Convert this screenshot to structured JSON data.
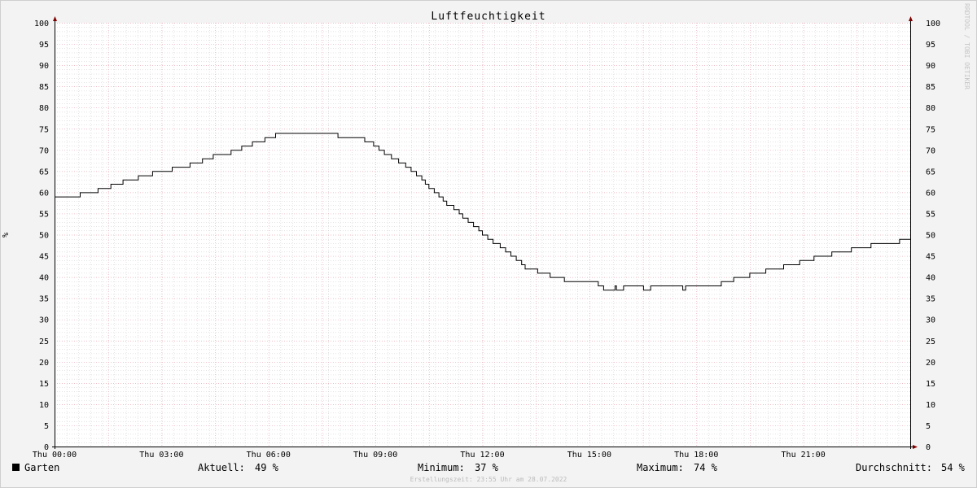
{
  "chart_data": {
    "type": "line",
    "title": "Luftfeuchtigkeit",
    "ylabel": "%",
    "ylim": [
      0,
      100
    ],
    "yticks": [
      0,
      5,
      10,
      15,
      20,
      25,
      30,
      35,
      40,
      45,
      50,
      55,
      60,
      65,
      70,
      75,
      80,
      85,
      90,
      95,
      100
    ],
    "xlim": [
      0,
      24
    ],
    "xticks": [
      {
        "value": 0,
        "label": "Thu 00:00"
      },
      {
        "value": 3,
        "label": "Thu 03:00"
      },
      {
        "value": 6,
        "label": "Thu 06:00"
      },
      {
        "value": 9,
        "label": "Thu 09:00"
      },
      {
        "value": 12,
        "label": "Thu 12:00"
      },
      {
        "value": 15,
        "label": "Thu 15:00"
      },
      {
        "value": 18,
        "label": "Thu 18:00"
      },
      {
        "value": 21,
        "label": "Thu 21:00"
      }
    ],
    "grid": true,
    "line_color": "#000000",
    "grid_minor_color": "#c8c8c8",
    "grid_major_color": "#e6a8b4",
    "arrow_color": "#800000",
    "series": [
      {
        "name": "Garten",
        "points": [
          [
            0.0,
            59
          ],
          [
            0.72,
            60
          ],
          [
            1.22,
            61
          ],
          [
            1.58,
            62
          ],
          [
            1.92,
            63
          ],
          [
            2.35,
            64
          ],
          [
            2.75,
            65
          ],
          [
            3.3,
            66
          ],
          [
            3.8,
            67
          ],
          [
            4.15,
            68
          ],
          [
            4.45,
            69
          ],
          [
            4.95,
            70
          ],
          [
            5.25,
            71
          ],
          [
            5.55,
            72
          ],
          [
            5.9,
            73
          ],
          [
            6.2,
            74
          ],
          [
            7.95,
            73
          ],
          [
            8.7,
            72
          ],
          [
            8.95,
            71
          ],
          [
            9.1,
            70
          ],
          [
            9.25,
            69
          ],
          [
            9.45,
            68
          ],
          [
            9.65,
            67
          ],
          [
            9.85,
            66
          ],
          [
            10.0,
            65
          ],
          [
            10.15,
            64
          ],
          [
            10.3,
            63
          ],
          [
            10.4,
            62
          ],
          [
            10.5,
            61
          ],
          [
            10.65,
            60
          ],
          [
            10.78,
            59
          ],
          [
            10.9,
            58
          ],
          [
            11.0,
            57
          ],
          [
            11.2,
            56
          ],
          [
            11.35,
            55
          ],
          [
            11.45,
            54
          ],
          [
            11.6,
            53
          ],
          [
            11.75,
            52
          ],
          [
            11.9,
            51
          ],
          [
            12.0,
            50
          ],
          [
            12.15,
            49
          ],
          [
            12.3,
            48
          ],
          [
            12.5,
            47
          ],
          [
            12.65,
            46
          ],
          [
            12.8,
            45
          ],
          [
            12.95,
            44
          ],
          [
            13.1,
            43
          ],
          [
            13.2,
            42
          ],
          [
            13.55,
            41
          ],
          [
            13.9,
            40
          ],
          [
            14.3,
            39
          ],
          [
            15.25,
            38
          ],
          [
            15.4,
            37
          ],
          [
            15.7,
            37
          ],
          [
            15.72,
            38
          ],
          [
            15.76,
            37
          ],
          [
            15.95,
            37
          ],
          [
            15.96,
            38
          ],
          [
            16.5,
            38
          ],
          [
            16.52,
            37
          ],
          [
            16.7,
            37
          ],
          [
            16.72,
            38
          ],
          [
            17.6,
            38
          ],
          [
            17.62,
            37
          ],
          [
            17.65,
            37
          ],
          [
            17.7,
            38
          ],
          [
            18.7,
            39
          ],
          [
            19.05,
            40
          ],
          [
            19.5,
            41
          ],
          [
            19.95,
            42
          ],
          [
            20.45,
            43
          ],
          [
            20.9,
            44
          ],
          [
            21.3,
            45
          ],
          [
            21.8,
            46
          ],
          [
            22.35,
            47
          ],
          [
            22.9,
            48
          ],
          [
            23.7,
            49
          ],
          [
            24.0,
            49
          ]
        ]
      }
    ]
  },
  "legend": {
    "series_name": "Garten",
    "current_label": "Aktuell:",
    "current_value": "49 %",
    "min_label": "Minimum:",
    "min_value": "37 %",
    "max_label": "Maximum:",
    "max_value": "74 %",
    "avg_label": "Durchschnitt:",
    "avg_value": "54 %"
  },
  "footer": "Erstellungszeit: 23:55 Uhr am 28.07.2022",
  "credit": "RRDTOOL / TOBI OETIKER"
}
